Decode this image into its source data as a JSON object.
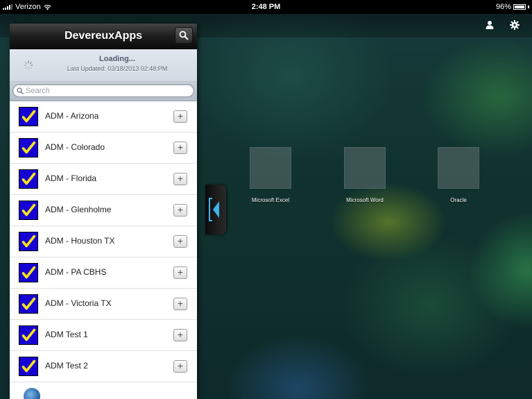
{
  "status_bar": {
    "carrier": "Verizon",
    "time": "2:48 PM",
    "battery": "96%"
  },
  "panel": {
    "title": "DevereuxApps",
    "loading_text": "Loading...",
    "last_updated": "Last Updated: 03/18/2013 02:48:PM",
    "search_placeholder": "Search",
    "items": [
      {
        "label": "ADM - Arizona",
        "add": "+"
      },
      {
        "label": "ADM - Colorado",
        "add": "+"
      },
      {
        "label": "ADM - Florida",
        "add": "+"
      },
      {
        "label": "ADM - Glenholme",
        "add": "+"
      },
      {
        "label": "ADM - Houston TX",
        "add": "+"
      },
      {
        "label": "ADM - PA CBHS",
        "add": "+"
      },
      {
        "label": "ADM - Victoria TX",
        "add": "+"
      },
      {
        "label": "ADM Test 1",
        "add": "+"
      },
      {
        "label": "ADM Test 2",
        "add": "+"
      }
    ]
  },
  "desktop": {
    "tiles": [
      {
        "label": "Microsoft Excel"
      },
      {
        "label": "Microsoft Word"
      },
      {
        "label": "Oracle"
      }
    ]
  },
  "icons": {
    "item_icon": "checkmark-icon",
    "handle": "collapse-arrow-icon",
    "topbar": [
      "user-icon",
      "gear-icon"
    ]
  },
  "colors": {
    "item_icon_bg": "#1700d4",
    "checkmark": "#f5e41a",
    "handle_arrow": "#3fb3ea"
  }
}
